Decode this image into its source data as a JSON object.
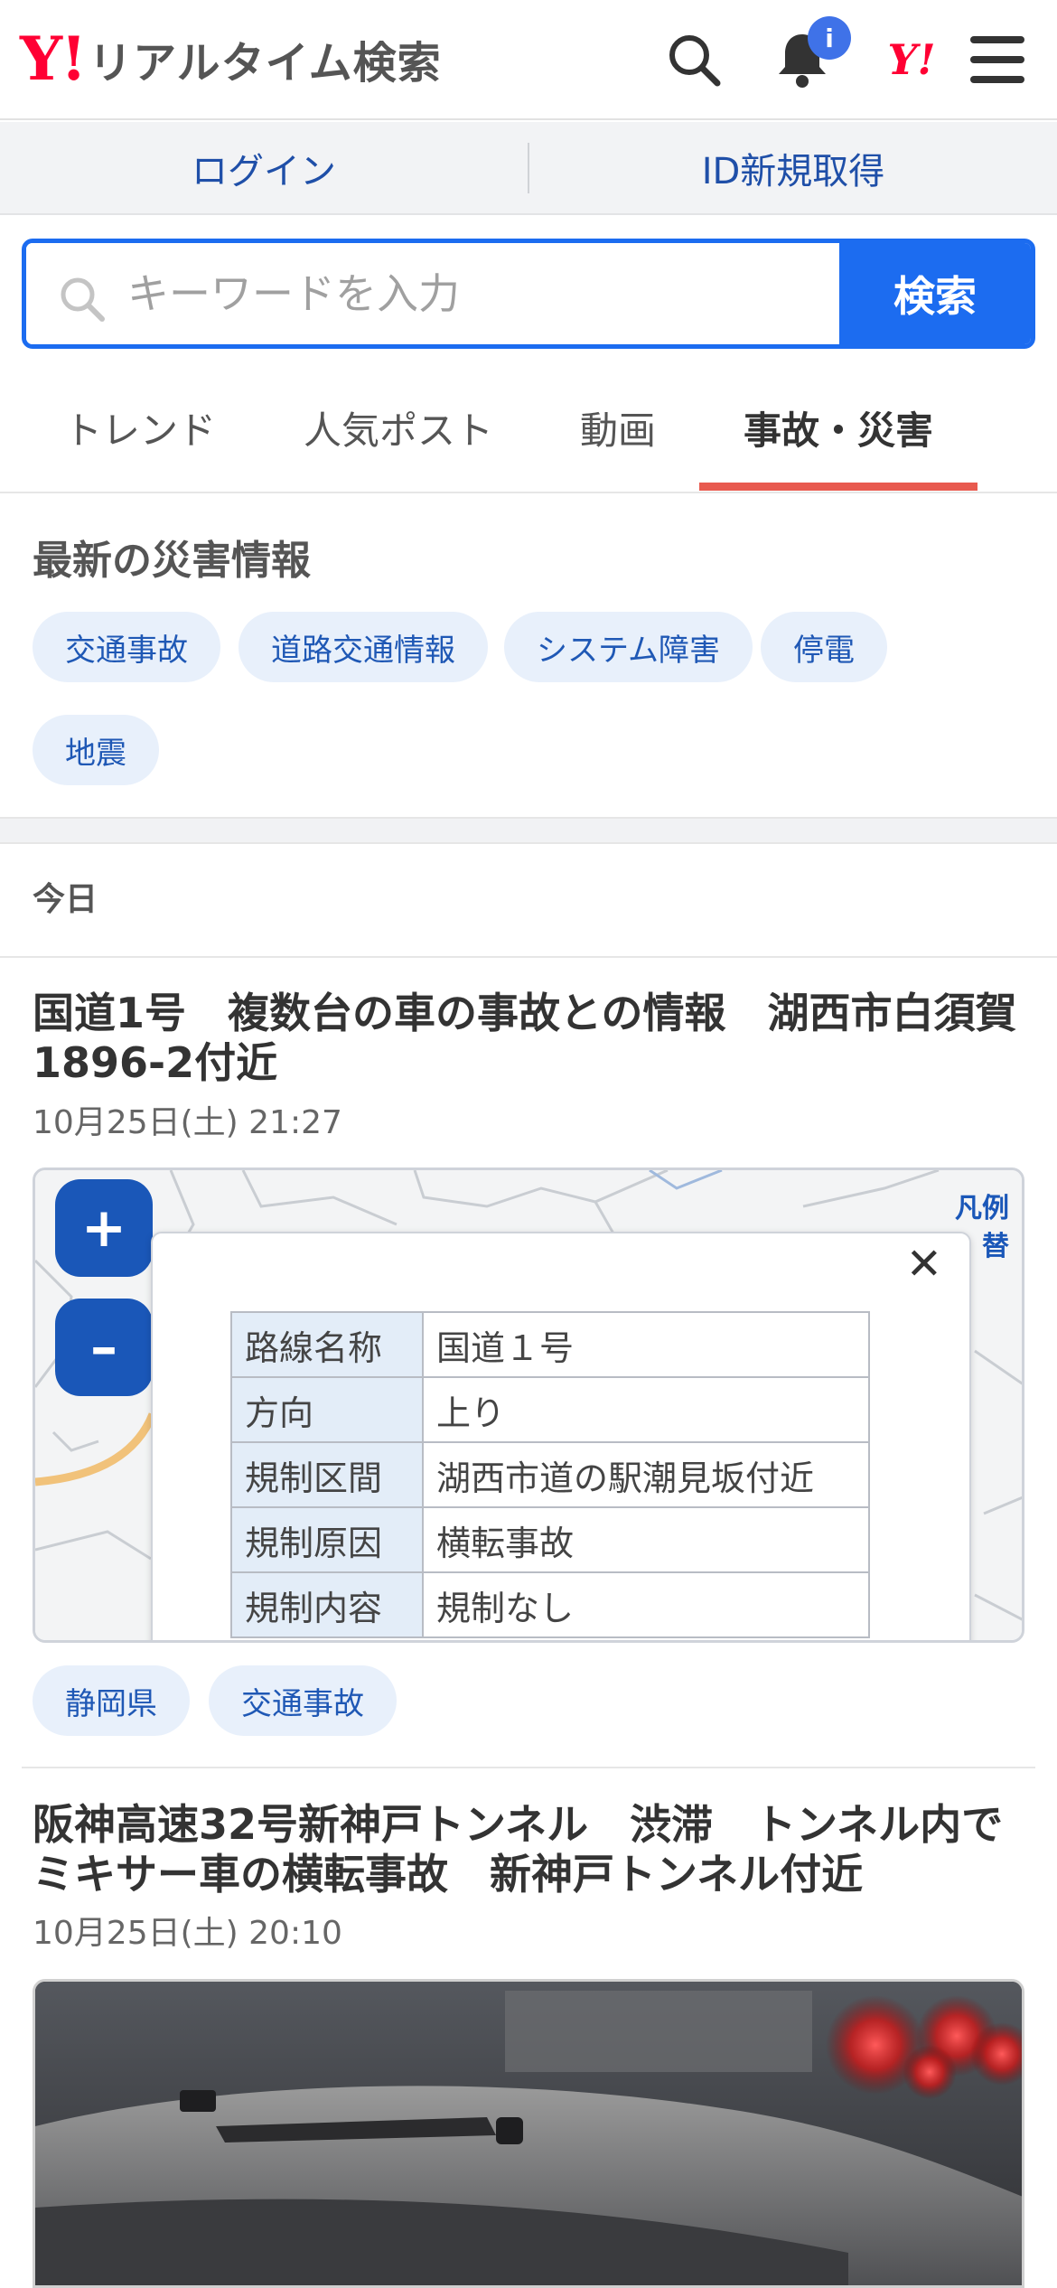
{
  "header": {
    "logo_mark": "Y!",
    "logo_text": "リアルタイム検索",
    "notification_badge": "i",
    "yj_logo": "Y!"
  },
  "account": {
    "login": "ログイン",
    "signup": "ID新規取得"
  },
  "search": {
    "placeholder": "キーワードを入力",
    "button": "検索"
  },
  "tabs": [
    {
      "label": "トレンド"
    },
    {
      "label": "人気ポスト"
    },
    {
      "label": "動画"
    },
    {
      "label": "事故・災害",
      "active": true
    }
  ],
  "disaster": {
    "title": "最新の災害情報",
    "tags": [
      "交通事故",
      "道路交通情報",
      "システム障害",
      "停電",
      "地震"
    ]
  },
  "feed": {
    "day_label": "今日",
    "posts": [
      {
        "title": "国道1号　複数台の車の事故との情報　湖西市白須賀1896-2付近",
        "time": "10月25日(土) 21:27",
        "map": {
          "zoom_in": "+",
          "zoom_out": "–",
          "legend_line1": "凡例",
          "legend_line2": "替",
          "close": "✕",
          "rows": [
            {
              "key": "路線名称",
              "value": "国道１号"
            },
            {
              "key": "方向",
              "value": "上り"
            },
            {
              "key": "規制区間",
              "value": "湖西市道の駅潮見坂付近"
            },
            {
              "key": "規制原因",
              "value": "横転事故"
            },
            {
              "key": "規制内容",
              "value": "規制なし"
            }
          ]
        },
        "tags": [
          "静岡県",
          "交通事故"
        ]
      },
      {
        "title": "阪神高速32号新神戸トンネル　渋滞　トンネル内でミキサー車の横転事故　新神戸トンネル付近",
        "time": "10月25日(土) 20:10"
      }
    ]
  },
  "colors": {
    "accent_blue": "#1c6cf0",
    "link_blue": "#1f4fa8",
    "brand_red": "#ff0033",
    "tab_underline": "#e85a4f",
    "chip_bg": "#e8f0fb"
  }
}
